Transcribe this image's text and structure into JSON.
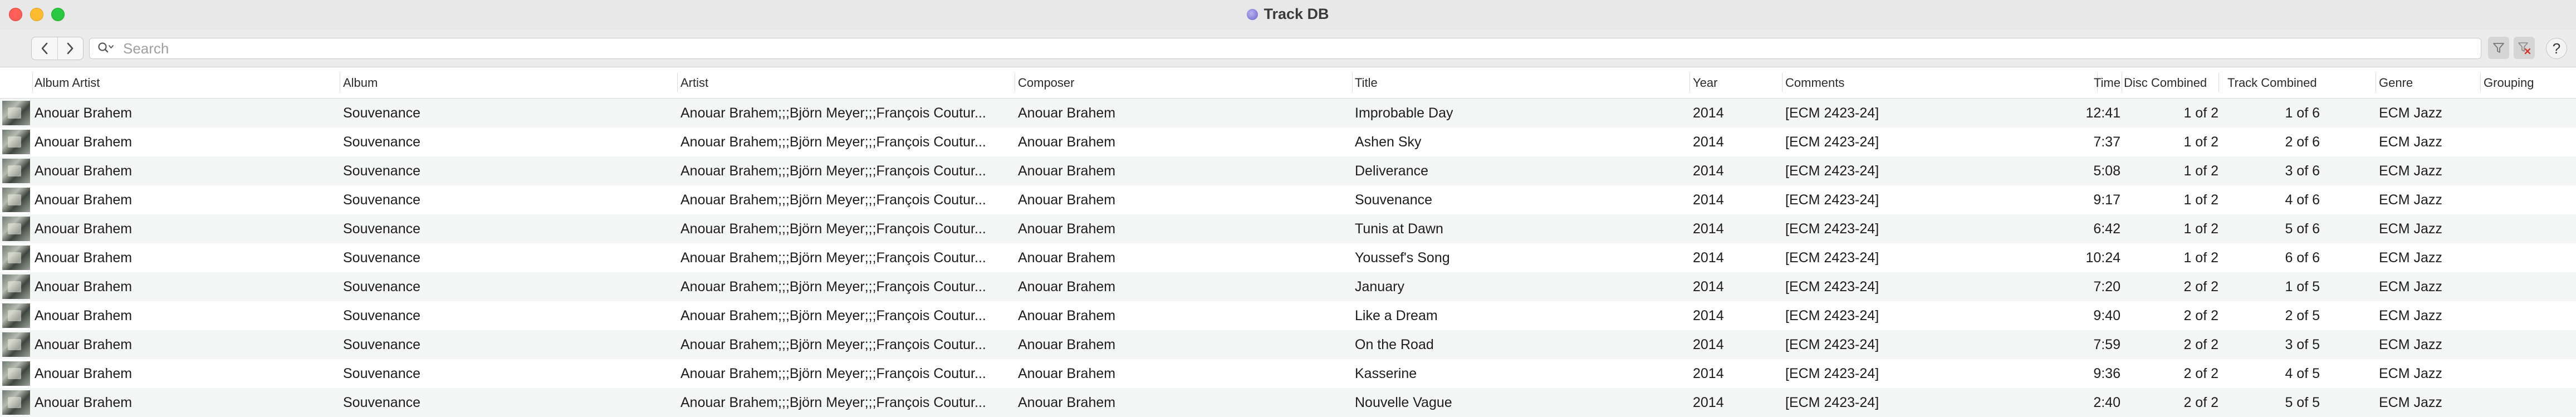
{
  "window": {
    "title": "Track DB"
  },
  "toolbar": {
    "search_placeholder": "Search",
    "help_label": "?"
  },
  "columns": {
    "album_artist": "Album Artist",
    "album": "Album",
    "artist": "Artist",
    "composer": "Composer",
    "title": "Title",
    "year": "Year",
    "comments": "Comments",
    "time": "Time",
    "disc_combined": "Disc Combined",
    "track_combined": "Track Combined",
    "genre": "Genre",
    "grouping": "Grouping"
  },
  "rows": [
    {
      "album_artist": "Anouar Brahem",
      "album": "Souvenance",
      "artist": "Anouar Brahem;;;Björn Meyer;;;François Coutur...",
      "composer": "Anouar Brahem",
      "title": "Improbable Day",
      "year": "2014",
      "comments": "[ECM 2423-24]",
      "time": "12:41",
      "disc": "1 of 2",
      "track": "1 of 6",
      "genre": "ECM Jazz",
      "grouping": ""
    },
    {
      "album_artist": "Anouar Brahem",
      "album": "Souvenance",
      "artist": "Anouar Brahem;;;Björn Meyer;;;François Coutur...",
      "composer": "Anouar Brahem",
      "title": "Ashen Sky",
      "year": "2014",
      "comments": "[ECM 2423-24]",
      "time": "7:37",
      "disc": "1 of 2",
      "track": "2 of 6",
      "genre": "ECM Jazz",
      "grouping": ""
    },
    {
      "album_artist": "Anouar Brahem",
      "album": "Souvenance",
      "artist": "Anouar Brahem;;;Björn Meyer;;;François Coutur...",
      "composer": "Anouar Brahem",
      "title": "Deliverance",
      "year": "2014",
      "comments": "[ECM 2423-24]",
      "time": "5:08",
      "disc": "1 of 2",
      "track": "3 of 6",
      "genre": "ECM Jazz",
      "grouping": ""
    },
    {
      "album_artist": "Anouar Brahem",
      "album": "Souvenance",
      "artist": "Anouar Brahem;;;Björn Meyer;;;François Coutur...",
      "composer": "Anouar Brahem",
      "title": "Souvenance",
      "year": "2014",
      "comments": "[ECM 2423-24]",
      "time": "9:17",
      "disc": "1 of 2",
      "track": "4 of 6",
      "genre": "ECM Jazz",
      "grouping": ""
    },
    {
      "album_artist": "Anouar Brahem",
      "album": "Souvenance",
      "artist": "Anouar Brahem;;;Björn Meyer;;;François Coutur...",
      "composer": "Anouar Brahem",
      "title": "Tunis at Dawn",
      "year": "2014",
      "comments": "[ECM 2423-24]",
      "time": "6:42",
      "disc": "1 of 2",
      "track": "5 of 6",
      "genre": "ECM Jazz",
      "grouping": ""
    },
    {
      "album_artist": "Anouar Brahem",
      "album": "Souvenance",
      "artist": "Anouar Brahem;;;Björn Meyer;;;François Coutur...",
      "composer": "Anouar Brahem",
      "title": "Youssef's Song",
      "year": "2014",
      "comments": "[ECM 2423-24]",
      "time": "10:24",
      "disc": "1 of 2",
      "track": "6 of 6",
      "genre": "ECM Jazz",
      "grouping": ""
    },
    {
      "album_artist": "Anouar Brahem",
      "album": "Souvenance",
      "artist": "Anouar Brahem;;;Björn Meyer;;;François Coutur...",
      "composer": "Anouar Brahem",
      "title": "January",
      "year": "2014",
      "comments": "[ECM 2423-24]",
      "time": "7:20",
      "disc": "2 of 2",
      "track": "1 of 5",
      "genre": "ECM Jazz",
      "grouping": ""
    },
    {
      "album_artist": "Anouar Brahem",
      "album": "Souvenance",
      "artist": "Anouar Brahem;;;Björn Meyer;;;François Coutur...",
      "composer": "Anouar Brahem",
      "title": "Like a Dream",
      "year": "2014",
      "comments": "[ECM 2423-24]",
      "time": "9:40",
      "disc": "2 of 2",
      "track": "2 of 5",
      "genre": "ECM Jazz",
      "grouping": ""
    },
    {
      "album_artist": "Anouar Brahem",
      "album": "Souvenance",
      "artist": "Anouar Brahem;;;Björn Meyer;;;François Coutur...",
      "composer": "Anouar Brahem",
      "title": "On the Road",
      "year": "2014",
      "comments": "[ECM 2423-24]",
      "time": "7:59",
      "disc": "2 of 2",
      "track": "3 of 5",
      "genre": "ECM Jazz",
      "grouping": ""
    },
    {
      "album_artist": "Anouar Brahem",
      "album": "Souvenance",
      "artist": "Anouar Brahem;;;Björn Meyer;;;François Coutur...",
      "composer": "Anouar Brahem",
      "title": "Kasserine",
      "year": "2014",
      "comments": "[ECM 2423-24]",
      "time": "9:36",
      "disc": "2 of 2",
      "track": "4 of 5",
      "genre": "ECM Jazz",
      "grouping": ""
    },
    {
      "album_artist": "Anouar Brahem",
      "album": "Souvenance",
      "artist": "Anouar Brahem;;;Björn Meyer;;;François Coutur...",
      "composer": "Anouar Brahem",
      "title": "Nouvelle Vague",
      "year": "2014",
      "comments": "[ECM 2423-24]",
      "time": "2:40",
      "disc": "2 of 2",
      "track": "5 of 5",
      "genre": "ECM Jazz",
      "grouping": ""
    }
  ]
}
